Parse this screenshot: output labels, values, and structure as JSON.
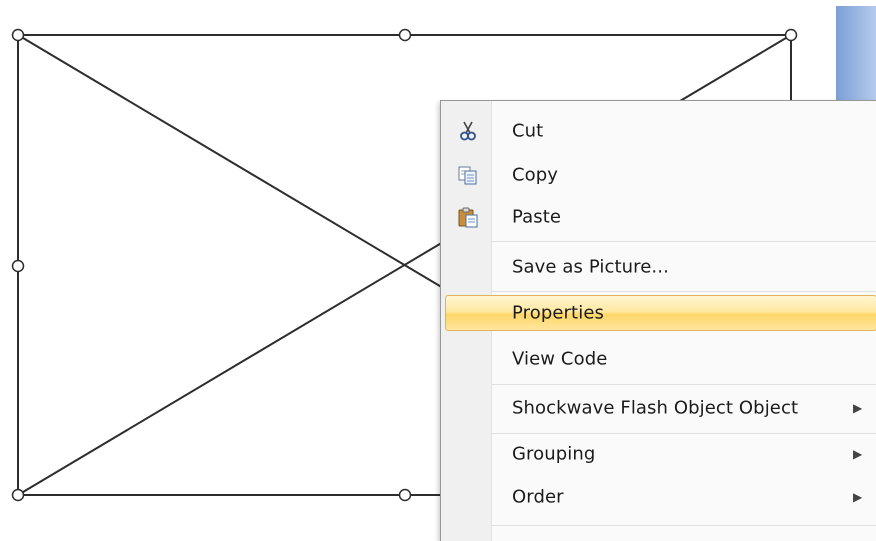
{
  "menu": {
    "items": [
      {
        "label": "Cut",
        "icon": "scissors-icon"
      },
      {
        "label": "Copy",
        "icon": "copy-icon"
      },
      {
        "label": "Paste",
        "icon": "paste-icon"
      },
      {
        "label": "Save as Picture..."
      },
      {
        "label": "Properties",
        "highlighted": true
      },
      {
        "label": "View Code"
      },
      {
        "label": "Shockwave Flash Object Object",
        "submenu": "▶"
      },
      {
        "label": "Grouping",
        "submenu": "▶"
      },
      {
        "label": "Order",
        "submenu": "▶"
      }
    ]
  },
  "colors": {
    "highlight_border": "#e3b35b",
    "highlight_fill": "#ffe19a",
    "object_stroke": "#2d2d2d",
    "side_strip": "#8eaadf"
  }
}
